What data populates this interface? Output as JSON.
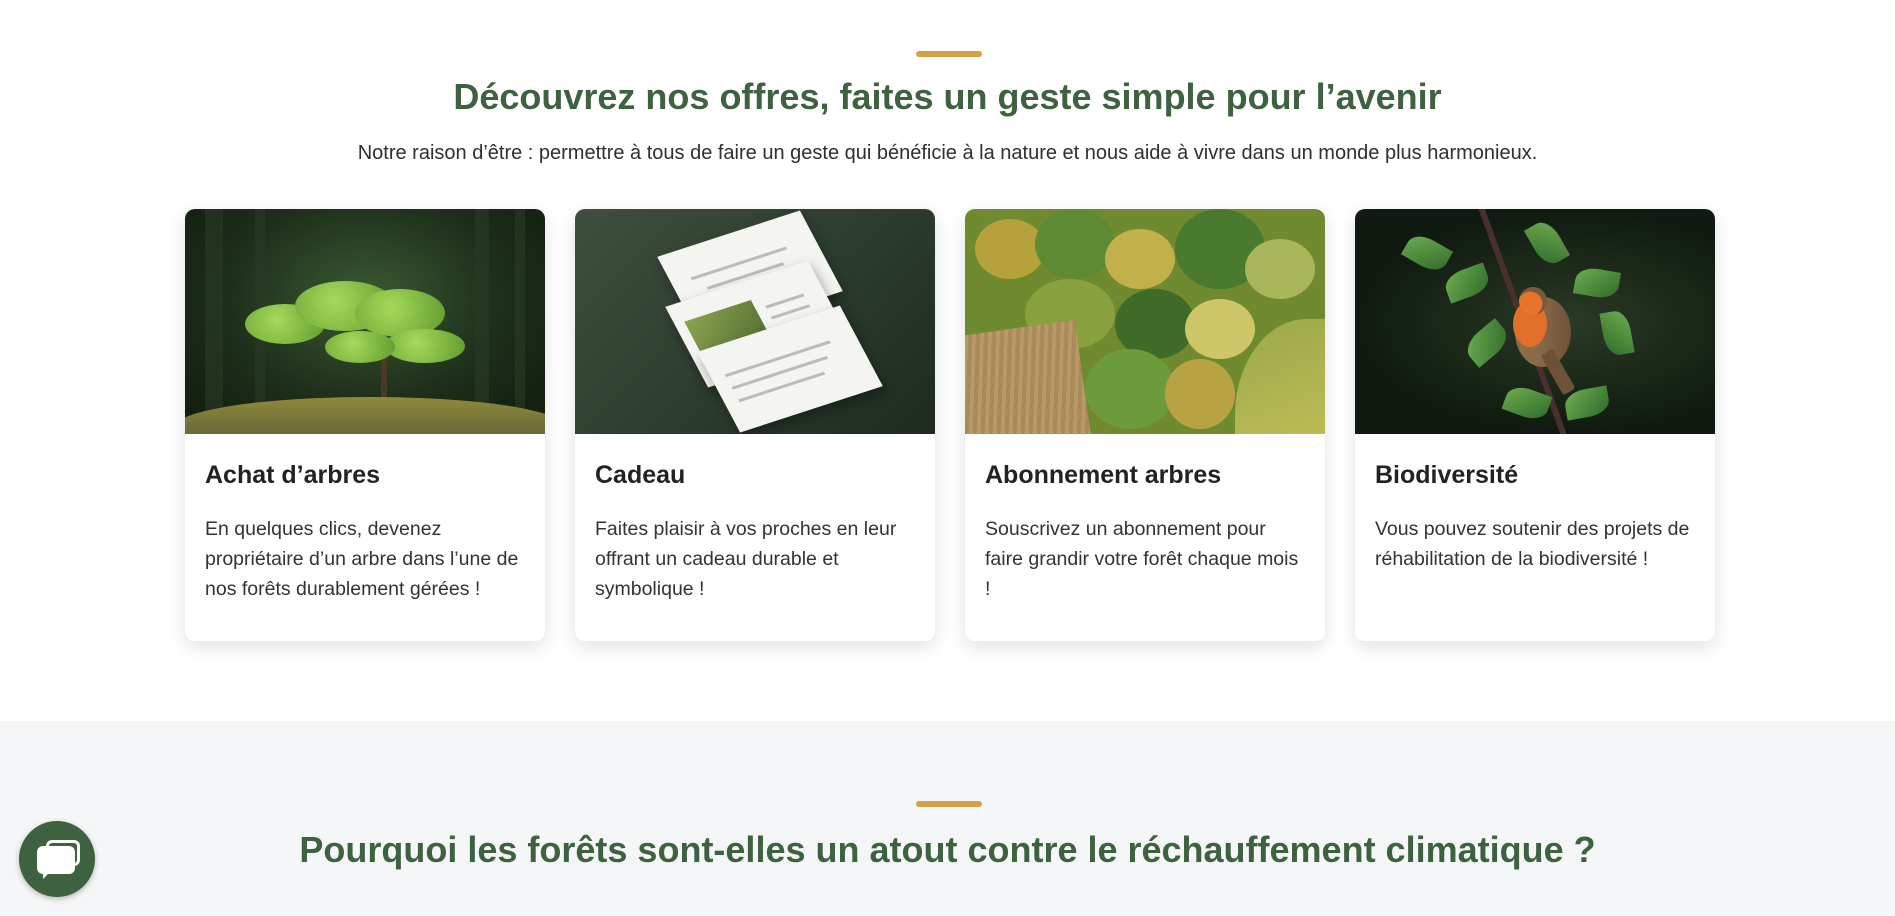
{
  "offers": {
    "title": "Découvrez nos offres, faites un geste simple pour l’avenir",
    "lead": "Notre raison d’être : permettre à tous de faire un geste qui bénéficie à la nature et nous aide à vivre dans un monde plus harmonieux.",
    "cards": [
      {
        "title": "Achat d’arbres",
        "description": "En quelques clics, devenez propriétaire d’un arbre dans l’une de nos forêts durablement gérées !",
        "image": "young-tree-on-mossy-rock"
      },
      {
        "title": "Cadeau",
        "description": "Faites plaisir à vos proches en leur offrant un cadeau durable et symbolique !",
        "image": "gift-certificate-sheets"
      },
      {
        "title": "Abonnement arbres",
        "description": "Souscrivez un abonnement pour faire grandir votre forêt chaque mois !",
        "image": "aerial-forest-view"
      },
      {
        "title": "Biodiversité",
        "description": "Vous pouvez soutenir des projets de réhabilitation de la biodiversité !",
        "image": "robin-on-branch"
      }
    ]
  },
  "why": {
    "title": "Pourquoi les forêts sont-elles un atout contre le réchauffement climatique ?"
  },
  "chat": {
    "icon": "chat-bubbles-icon"
  },
  "colors": {
    "accent": "#d4a045",
    "brand_green": "#3e6140",
    "section_bg": "#f5f6f7"
  }
}
